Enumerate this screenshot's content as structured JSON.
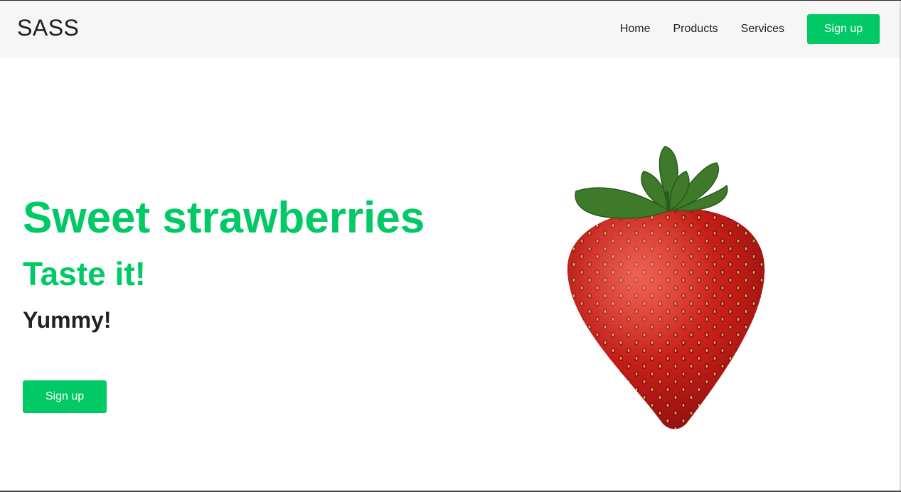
{
  "navbar": {
    "brand": "SASS",
    "links": [
      "Home",
      "Products",
      "Services"
    ],
    "signup_label": "Sign up"
  },
  "hero": {
    "title": "Sweet strawberries",
    "subtitle": "Taste it!",
    "tagline": "Yummy!",
    "signup_label": "Sign up",
    "image_icon": "strawberry-image"
  },
  "colors": {
    "accent": "#00c965",
    "navbar_bg": "#f6f6f6",
    "text_dark": "#222222"
  }
}
